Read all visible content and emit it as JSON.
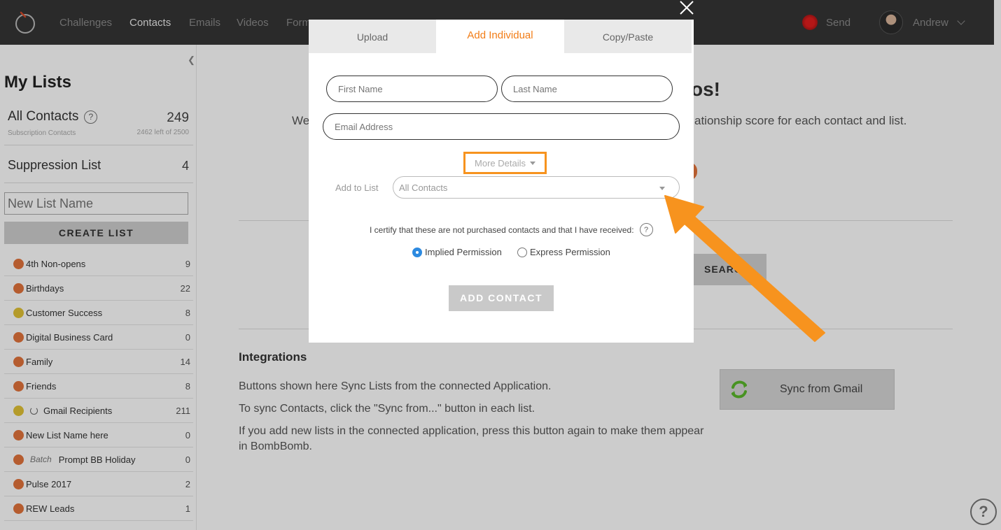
{
  "nav": {
    "items": [
      {
        "label": "Challenges",
        "active": false
      },
      {
        "label": "Contacts",
        "active": true
      },
      {
        "label": "Emails",
        "active": false
      },
      {
        "label": "Videos",
        "active": false
      },
      {
        "label": "Form",
        "active": false
      }
    ],
    "send_label": "Send",
    "user_name": "Andrew"
  },
  "sidebar": {
    "title": "My Lists",
    "all_contacts": {
      "label": "All Contacts",
      "help": "?",
      "count": "249",
      "sub_label": "Subscription Contacts",
      "remaining": "2462 left of 2500"
    },
    "suppression": {
      "label": "Suppression List",
      "count": "4"
    },
    "new_list_placeholder": "New List Name",
    "create_label": "CREATE LIST",
    "lists": [
      {
        "label": "4th Non-opens",
        "count": "9",
        "mood": "sad"
      },
      {
        "label": "Birthdays",
        "count": "22",
        "mood": "sad"
      },
      {
        "label": "Customer Success",
        "count": "8",
        "mood": "neutral"
      },
      {
        "label": "Digital Business Card",
        "count": "0",
        "mood": "sad"
      },
      {
        "label": "Family",
        "count": "14",
        "mood": "sad"
      },
      {
        "label": "Friends",
        "count": "8",
        "mood": "sad"
      },
      {
        "label": "Gmail Recipients",
        "count": "211",
        "mood": "neutral",
        "synced": true
      },
      {
        "label": "New List Name here",
        "count": "0",
        "mood": "sad"
      },
      {
        "label": "Prompt BB Holiday",
        "count": "0",
        "mood": "sad",
        "batch": "Batch"
      },
      {
        "label": "Pulse 2017",
        "count": "2",
        "mood": "sad"
      },
      {
        "label": "REW Leads",
        "count": "1",
        "mood": "sad"
      }
    ]
  },
  "main": {
    "title_tail": "os!",
    "desc_head": "We",
    "desc_tail": "ationship score for each contact and list.",
    "search_label": "SEARCH",
    "integrations": {
      "title": "Integrations",
      "lines": [
        "Buttons shown here Sync Lists from the connected Application.",
        "To sync Contacts, click the \"Sync from...\" button in each list.",
        "If you add new lists in the connected application, press this button again to make them appear in BombBomb."
      ],
      "sync_label": "Sync from Gmail"
    },
    "help_label": "?"
  },
  "modal": {
    "tabs": [
      {
        "label": "Upload",
        "active": false
      },
      {
        "label": "Add Individual",
        "active": true
      },
      {
        "label": "Copy/Paste",
        "active": false
      }
    ],
    "first_name_placeholder": "First Name",
    "last_name_placeholder": "Last Name",
    "email_placeholder": "Email Address",
    "more_details": "More Details",
    "add_to_list_label": "Add to List",
    "add_to_list_value": "All Contacts",
    "certify_text": "I certify that these are not purchased contacts and that I have received:",
    "certify_help": "?",
    "permissions": [
      {
        "label": "Implied Permission",
        "checked": true
      },
      {
        "label": "Express Permission",
        "checked": false
      }
    ],
    "add_contact_label": "ADD CONTACT"
  },
  "colors": {
    "accent": "#f27d17",
    "highlight_border": "#f7931e",
    "arrow": "#f7931e",
    "radio_checked": "#2d8ae0",
    "sad_face": "#e3743b",
    "neutral_face": "#e2c235"
  }
}
